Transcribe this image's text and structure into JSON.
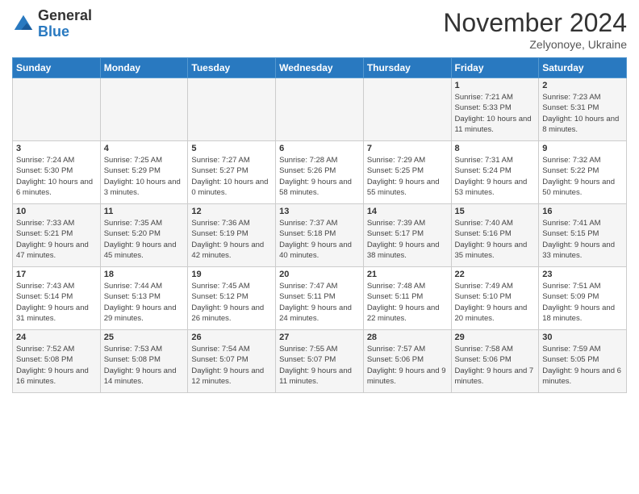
{
  "logo": {
    "line1": "General",
    "line2": "Blue"
  },
  "title": "November 2024",
  "subtitle": "Zelyonoye, Ukraine",
  "weekdays": [
    "Sunday",
    "Monday",
    "Tuesday",
    "Wednesday",
    "Thursday",
    "Friday",
    "Saturday"
  ],
  "weeks": [
    [
      {
        "day": "",
        "info": ""
      },
      {
        "day": "",
        "info": ""
      },
      {
        "day": "",
        "info": ""
      },
      {
        "day": "",
        "info": ""
      },
      {
        "day": "",
        "info": ""
      },
      {
        "day": "1",
        "info": "Sunrise: 7:21 AM\nSunset: 5:33 PM\nDaylight: 10 hours and 11 minutes."
      },
      {
        "day": "2",
        "info": "Sunrise: 7:23 AM\nSunset: 5:31 PM\nDaylight: 10 hours and 8 minutes."
      }
    ],
    [
      {
        "day": "3",
        "info": "Sunrise: 7:24 AM\nSunset: 5:30 PM\nDaylight: 10 hours and 6 minutes."
      },
      {
        "day": "4",
        "info": "Sunrise: 7:25 AM\nSunset: 5:29 PM\nDaylight: 10 hours and 3 minutes."
      },
      {
        "day": "5",
        "info": "Sunrise: 7:27 AM\nSunset: 5:27 PM\nDaylight: 10 hours and 0 minutes."
      },
      {
        "day": "6",
        "info": "Sunrise: 7:28 AM\nSunset: 5:26 PM\nDaylight: 9 hours and 58 minutes."
      },
      {
        "day": "7",
        "info": "Sunrise: 7:29 AM\nSunset: 5:25 PM\nDaylight: 9 hours and 55 minutes."
      },
      {
        "day": "8",
        "info": "Sunrise: 7:31 AM\nSunset: 5:24 PM\nDaylight: 9 hours and 53 minutes."
      },
      {
        "day": "9",
        "info": "Sunrise: 7:32 AM\nSunset: 5:22 PM\nDaylight: 9 hours and 50 minutes."
      }
    ],
    [
      {
        "day": "10",
        "info": "Sunrise: 7:33 AM\nSunset: 5:21 PM\nDaylight: 9 hours and 47 minutes."
      },
      {
        "day": "11",
        "info": "Sunrise: 7:35 AM\nSunset: 5:20 PM\nDaylight: 9 hours and 45 minutes."
      },
      {
        "day": "12",
        "info": "Sunrise: 7:36 AM\nSunset: 5:19 PM\nDaylight: 9 hours and 42 minutes."
      },
      {
        "day": "13",
        "info": "Sunrise: 7:37 AM\nSunset: 5:18 PM\nDaylight: 9 hours and 40 minutes."
      },
      {
        "day": "14",
        "info": "Sunrise: 7:39 AM\nSunset: 5:17 PM\nDaylight: 9 hours and 38 minutes."
      },
      {
        "day": "15",
        "info": "Sunrise: 7:40 AM\nSunset: 5:16 PM\nDaylight: 9 hours and 35 minutes."
      },
      {
        "day": "16",
        "info": "Sunrise: 7:41 AM\nSunset: 5:15 PM\nDaylight: 9 hours and 33 minutes."
      }
    ],
    [
      {
        "day": "17",
        "info": "Sunrise: 7:43 AM\nSunset: 5:14 PM\nDaylight: 9 hours and 31 minutes."
      },
      {
        "day": "18",
        "info": "Sunrise: 7:44 AM\nSunset: 5:13 PM\nDaylight: 9 hours and 29 minutes."
      },
      {
        "day": "19",
        "info": "Sunrise: 7:45 AM\nSunset: 5:12 PM\nDaylight: 9 hours and 26 minutes."
      },
      {
        "day": "20",
        "info": "Sunrise: 7:47 AM\nSunset: 5:11 PM\nDaylight: 9 hours and 24 minutes."
      },
      {
        "day": "21",
        "info": "Sunrise: 7:48 AM\nSunset: 5:11 PM\nDaylight: 9 hours and 22 minutes."
      },
      {
        "day": "22",
        "info": "Sunrise: 7:49 AM\nSunset: 5:10 PM\nDaylight: 9 hours and 20 minutes."
      },
      {
        "day": "23",
        "info": "Sunrise: 7:51 AM\nSunset: 5:09 PM\nDaylight: 9 hours and 18 minutes."
      }
    ],
    [
      {
        "day": "24",
        "info": "Sunrise: 7:52 AM\nSunset: 5:08 PM\nDaylight: 9 hours and 16 minutes."
      },
      {
        "day": "25",
        "info": "Sunrise: 7:53 AM\nSunset: 5:08 PM\nDaylight: 9 hours and 14 minutes."
      },
      {
        "day": "26",
        "info": "Sunrise: 7:54 AM\nSunset: 5:07 PM\nDaylight: 9 hours and 12 minutes."
      },
      {
        "day": "27",
        "info": "Sunrise: 7:55 AM\nSunset: 5:07 PM\nDaylight: 9 hours and 11 minutes."
      },
      {
        "day": "28",
        "info": "Sunrise: 7:57 AM\nSunset: 5:06 PM\nDaylight: 9 hours and 9 minutes."
      },
      {
        "day": "29",
        "info": "Sunrise: 7:58 AM\nSunset: 5:06 PM\nDaylight: 9 hours and 7 minutes."
      },
      {
        "day": "30",
        "info": "Sunrise: 7:59 AM\nSunset: 5:05 PM\nDaylight: 9 hours and 6 minutes."
      }
    ]
  ]
}
